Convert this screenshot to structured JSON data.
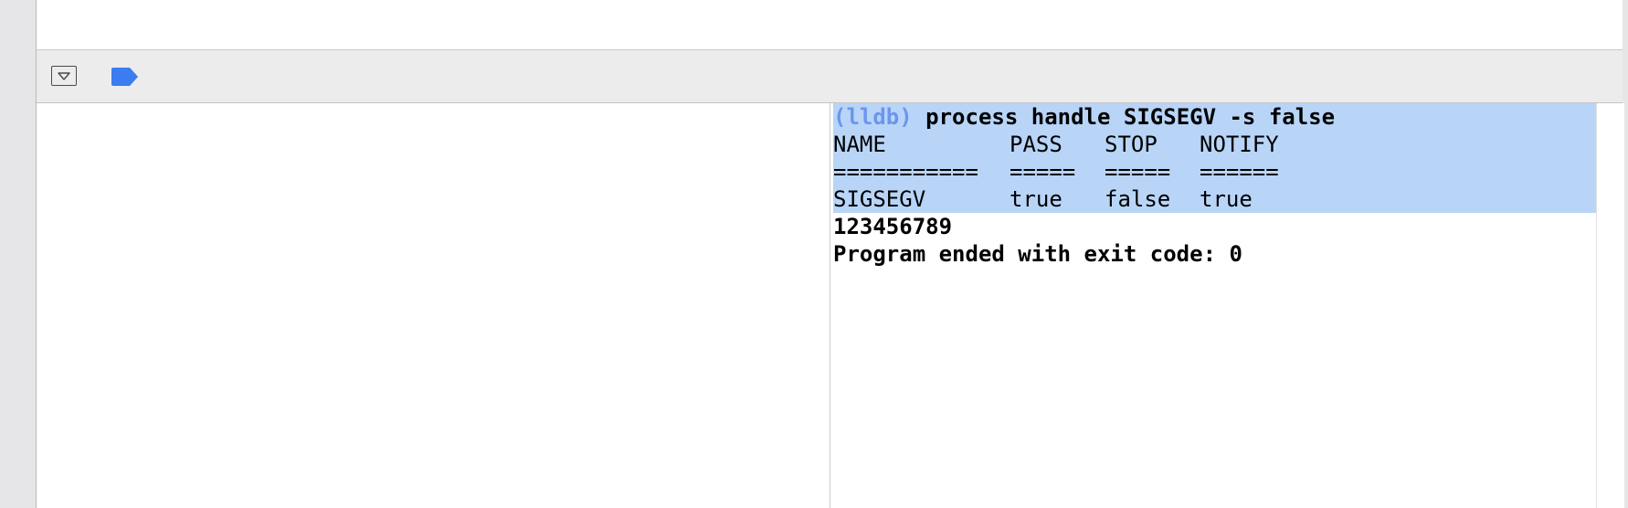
{
  "console": {
    "prompt": "(lldb)",
    "command": " process handle SIGSEGV -s false",
    "table": {
      "headers": [
        "NAME",
        "PASS",
        "STOP",
        "NOTIFY"
      ],
      "separators": [
        "===========",
        "=====",
        "=====",
        "======"
      ],
      "row": [
        "SIGSEGV",
        "true",
        "false",
        "true"
      ]
    },
    "output": [
      "123456789",
      "Program ended with exit code: 0"
    ]
  },
  "icons": {
    "hide_toggle": "hide-debug-area-icon",
    "breakpoints": "breakpoint-toggle-icon"
  },
  "colors": {
    "selection": "#b8d5f8",
    "prompt": "#6a96ec",
    "breakpoint": "#3b7cf0"
  }
}
